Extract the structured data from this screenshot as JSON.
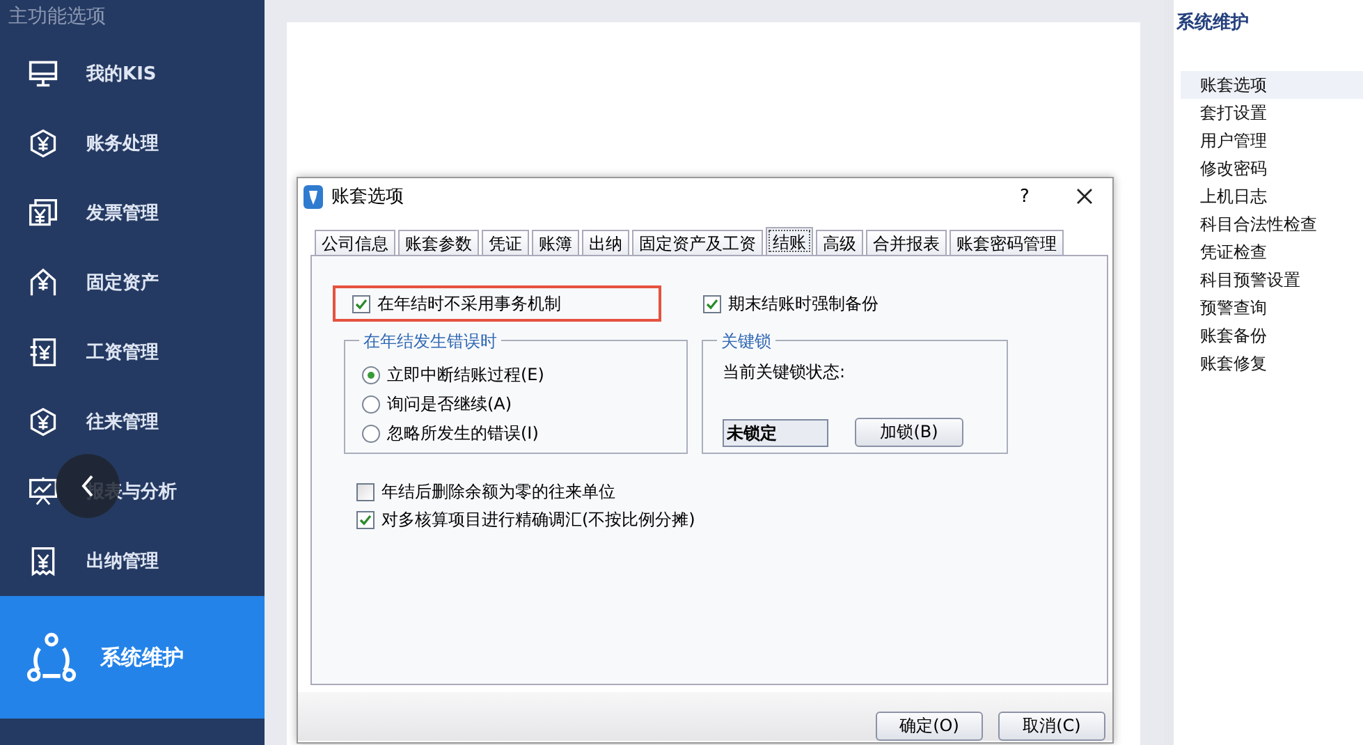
{
  "sidebar": {
    "header": "主功能选项",
    "items": [
      {
        "label": "我的KIS",
        "selected": false
      },
      {
        "label": "账务处理",
        "selected": false
      },
      {
        "label": "发票管理",
        "selected": false
      },
      {
        "label": "固定资产",
        "selected": false
      },
      {
        "label": "工资管理",
        "selected": false
      },
      {
        "label": "往来管理",
        "selected": false
      },
      {
        "label": "报表与分析",
        "selected": false
      },
      {
        "label": "出纳管理",
        "selected": false
      },
      {
        "label": "系统维护",
        "selected": true
      }
    ]
  },
  "dialog": {
    "title": "账套选项",
    "help": "?",
    "tabs": [
      {
        "label": "公司信息",
        "selected": false
      },
      {
        "label": "账套参数",
        "selected": false
      },
      {
        "label": "凭证",
        "selected": false
      },
      {
        "label": "账簿",
        "selected": false
      },
      {
        "label": "出纳",
        "selected": false
      },
      {
        "label": "固定资产及工资",
        "selected": false
      },
      {
        "label": "结账",
        "selected": true
      },
      {
        "label": "高级",
        "selected": false
      },
      {
        "label": "合并报表",
        "selected": false
      },
      {
        "label": "账套密码管理",
        "selected": false
      }
    ],
    "top_options": [
      {
        "label": "在年结时不采用事务机制",
        "checked": true,
        "highlighted": true
      },
      {
        "label": "期末结账时强制备份",
        "checked": true,
        "highlighted": false
      }
    ],
    "error_group": {
      "title": "在年结发生错误时",
      "radios": [
        {
          "label": "立即中断结账过程(E)",
          "selected": true
        },
        {
          "label": "询问是否继续(A)",
          "selected": false
        },
        {
          "label": "忽略所发生的错误(I)",
          "selected": false
        }
      ]
    },
    "lock_group": {
      "title": "关键锁",
      "status_label": "当前关键锁状态:",
      "status_value": "未锁定",
      "button": "加锁(B)"
    },
    "bottom_options": [
      {
        "label": "年结后删除余额为零的往来单位",
        "checked": false
      },
      {
        "label": "对多核算项目进行精确调汇(不按比例分摊)",
        "checked": true
      }
    ],
    "buttons": [
      "确定(O)",
      "取消(C)"
    ]
  },
  "right_panel": {
    "title": "系统维护",
    "items": [
      {
        "label": "账套选项",
        "selected": true
      },
      {
        "label": "套打设置",
        "selected": false
      },
      {
        "label": "用户管理",
        "selected": false
      },
      {
        "label": "修改密码",
        "selected": false
      },
      {
        "label": "上机日志",
        "selected": false
      },
      {
        "label": "科目合法性检查",
        "selected": false
      },
      {
        "label": "凭证检查",
        "selected": false
      },
      {
        "label": "科目预警设置",
        "selected": false
      },
      {
        "label": "预警查询",
        "selected": false
      },
      {
        "label": "账套备份",
        "selected": false
      },
      {
        "label": "账套修复",
        "selected": false
      }
    ]
  }
}
